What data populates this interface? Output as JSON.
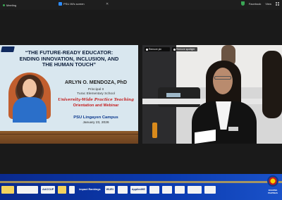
{
  "topbar": {
    "app_title": "Meeting",
    "share_label": "PSU IM's screen",
    "facebook_label": "Facebook",
    "view_label": "View"
  },
  "slide": {
    "title_line1": "“THE FUTURE-READY EDUCATOR:",
    "title_line2": "ENDING INNOVATION, INCLUSION, AND",
    "title_line3": "THE HUMAN TOUCH”",
    "speaker_name": "ARLYN O. MENDOZA, PhD",
    "speaker_role": "Principal II",
    "speaker_school": "Turac Elementary School",
    "event_line1": "University-Wide Practice Teaching",
    "event_line2": "Orientation and Webinar",
    "campus": "PSU Lingayen Campus",
    "date": "January 23, 2026"
  },
  "camera": {
    "pill_remove_pin": "Remove pin",
    "pill_remove_spotlight": "Remove spotlight"
  },
  "banner": {
    "logos": [
      "",
      "AACCUP",
      "",
      "Impact Rankings",
      "WURI",
      "AppliedHE",
      "",
      "",
      "",
      ""
    ],
    "bagong_text": "BAGONG PILIPINAS"
  }
}
